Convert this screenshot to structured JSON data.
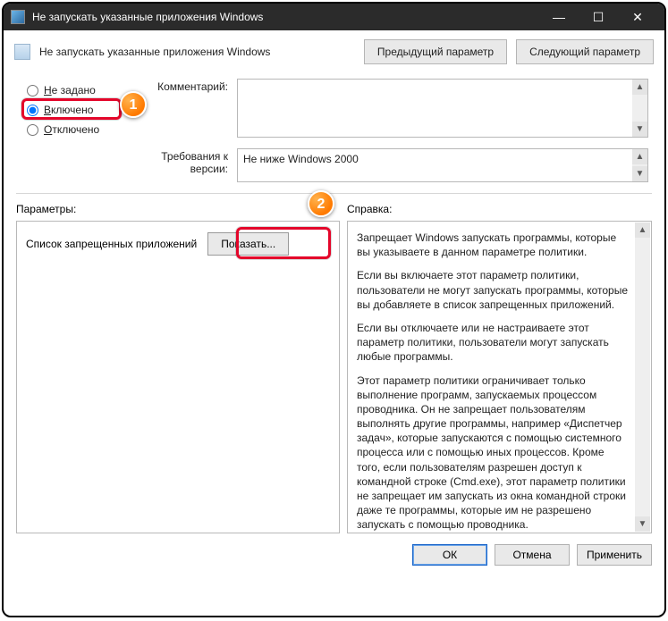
{
  "window": {
    "title": "Не запускать указанные приложения Windows",
    "min_label": "—",
    "max_label": "☐",
    "close_label": "✕"
  },
  "header": {
    "title": "Не запускать указанные приложения Windows",
    "prev_label": "Предыдущий параметр",
    "next_label": "Следующий параметр"
  },
  "radios": {
    "not_configured": "Не задано",
    "enabled": "Включено",
    "disabled": "Отключено"
  },
  "annotations": {
    "badge1": "1",
    "badge2": "2"
  },
  "comment": {
    "label": "Комментарий:",
    "value": ""
  },
  "requirements": {
    "label": "Требования к версии:",
    "value": "Не ниже Windows 2000"
  },
  "sections": {
    "params": "Параметры:",
    "help": "Справка:"
  },
  "params_panel": {
    "line_label": "Список запрещенных приложений",
    "show_button": "Показать..."
  },
  "help_panel": {
    "p1": "Запрещает Windows запускать программы, которые вы указываете в данном параметре политики.",
    "p2": "Если вы включаете этот параметр политики, пользователи не могут запускать программы, которые вы добавляете в список запрещенных приложений.",
    "p3": "Если вы отключаете или не настраиваете этот параметр политики, пользователи могут запускать любые программы.",
    "p4": "Этот параметр политики ограничивает только выполнение программ, запускаемых процессом проводника. Он не запрещает пользователям выполнять другие программы, например «Диспетчер задач», которые запускаются с помощью системного процесса или с помощью иных процессов.  Кроме того, если пользователям разрешен доступ к командной строке (Cmd.exe), этот параметр политики не запрещает им запускать из окна командной строки даже те программы, которые им не разрешено запускать с помощью проводника."
  },
  "footer": {
    "ok": "ОК",
    "cancel": "Отмена",
    "apply": "Применить"
  }
}
